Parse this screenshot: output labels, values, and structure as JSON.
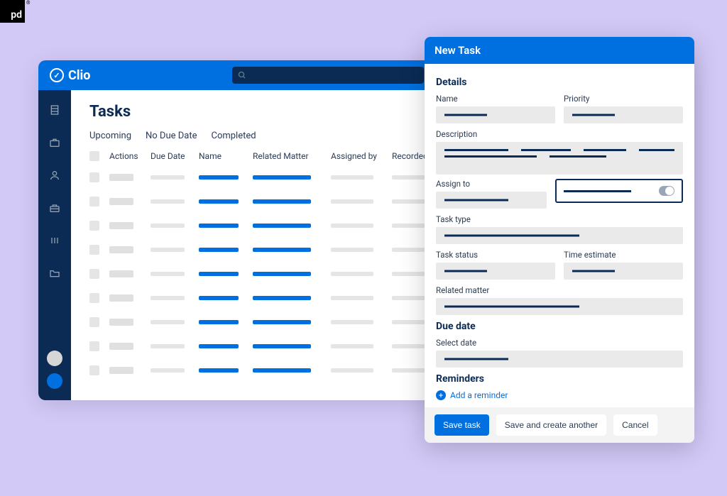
{
  "brand": {
    "name": "Clio"
  },
  "search": {
    "placeholder": ""
  },
  "sidebar": {
    "items": [
      {
        "icon": "building"
      },
      {
        "icon": "briefcase"
      },
      {
        "icon": "person"
      },
      {
        "icon": "toolbox"
      },
      {
        "icon": "bars"
      },
      {
        "icon": "folder"
      }
    ]
  },
  "page": {
    "title": "Tasks"
  },
  "tabs": [
    {
      "label": "Upcoming"
    },
    {
      "label": "No Due Date"
    },
    {
      "label": "Completed"
    }
  ],
  "columns": {
    "actions": "Actions",
    "due": "Due Date",
    "name": "Name",
    "matter": "Related Matter",
    "assigned": "Assigned by",
    "recorded": "Recorded"
  },
  "rows_count": 9,
  "modal": {
    "title": "New Task",
    "sections": {
      "details": "Details",
      "due": "Due date",
      "reminders": "Reminders"
    },
    "fields": {
      "name": "Name",
      "priority": "Priority",
      "description": "Description",
      "assign_to": "Assign to",
      "task_type": "Task type",
      "task_status": "Task status",
      "time_estimate": "Time estimate",
      "related_matter": "Related matter",
      "select_date": "Select date"
    },
    "add_reminder": "Add a reminder",
    "buttons": {
      "save": "Save task",
      "save_another": "Save and create another",
      "cancel": "Cancel"
    }
  }
}
